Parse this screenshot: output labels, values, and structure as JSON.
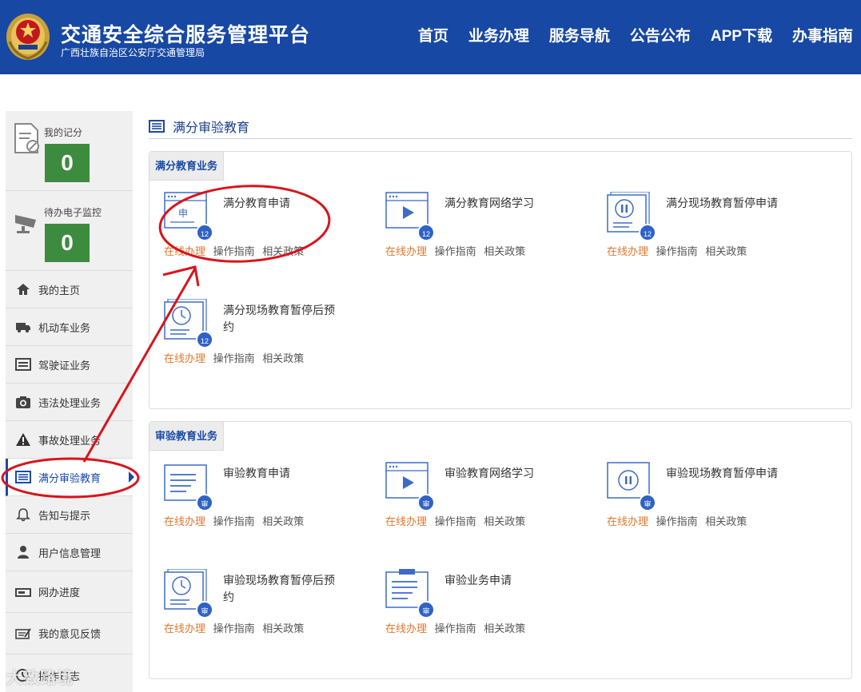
{
  "header": {
    "title": "交通安全综合服务管理平台",
    "subtitle": "广西壮族自治区公安厅交通管理局",
    "nav": [
      "首页",
      "业务办理",
      "服务导航",
      "公告公布",
      "APP下载",
      "办事指南"
    ],
    "bg_color": "#1748a3"
  },
  "sidebar": {
    "score": {
      "label": "我的记分",
      "value": "0"
    },
    "monitor": {
      "label": "待办电子监控",
      "value": "0"
    },
    "items": [
      {
        "label": "我的主页",
        "icon": "home-icon"
      },
      {
        "label": "机动车业务",
        "icon": "truck-icon"
      },
      {
        "label": "驾驶证业务",
        "icon": "card-icon"
      },
      {
        "label": "违法处理业务",
        "icon": "camera-icon"
      },
      {
        "label": "事故处理业务",
        "icon": "warning-icon"
      },
      {
        "label": "满分审验教育",
        "icon": "list-icon"
      },
      {
        "label": "告知与提示",
        "icon": "bell-icon"
      },
      {
        "label": "用户信息管理",
        "icon": "user-icon"
      },
      {
        "label": "网办进度",
        "icon": "progress-icon"
      },
      {
        "label": "我的意见反馈",
        "icon": "feedback-icon"
      },
      {
        "label": "操作日志",
        "icon": "log-icon"
      }
    ],
    "active_index": 5
  },
  "breadcrumb": {
    "title": "满分审验教育"
  },
  "sections": [
    {
      "title": "满分教育业务",
      "cards": [
        {
          "title": "满分教育申请",
          "icon": "apply-icon",
          "badge": "12"
        },
        {
          "title": "满分教育网络学习",
          "icon": "video-icon",
          "badge": "12"
        },
        {
          "title": "满分现场教育暂停申请",
          "icon": "pause-icon",
          "badge": "12"
        },
        {
          "title": "满分现场教育暂停后预约",
          "icon": "clock-icon",
          "badge": "12"
        }
      ]
    },
    {
      "title": "审验教育业务",
      "cards": [
        {
          "title": "审验教育申请",
          "icon": "document-icon",
          "badge": "审"
        },
        {
          "title": "审验教育网络学习",
          "icon": "video-icon",
          "badge": "审"
        },
        {
          "title": "审验现场教育暂停申请",
          "icon": "pause-icon",
          "badge": "审"
        },
        {
          "title": "审验现场教育暂停后预约",
          "icon": "clock-icon",
          "badge": "审"
        },
        {
          "title": "审验业务申请",
          "icon": "clipboard-icon",
          "badge": "审"
        }
      ]
    }
  ],
  "card_links": {
    "online": "在线办理",
    "guide": "操作指南",
    "policy": "相关政策"
  },
  "app_icon_label": "申",
  "watermark": "大致路境",
  "colors": {
    "accent": "#1a4aa6",
    "link_orange": "#e0772c",
    "score_green": "#3d8b3f",
    "annotation_red": "#d8141c"
  }
}
